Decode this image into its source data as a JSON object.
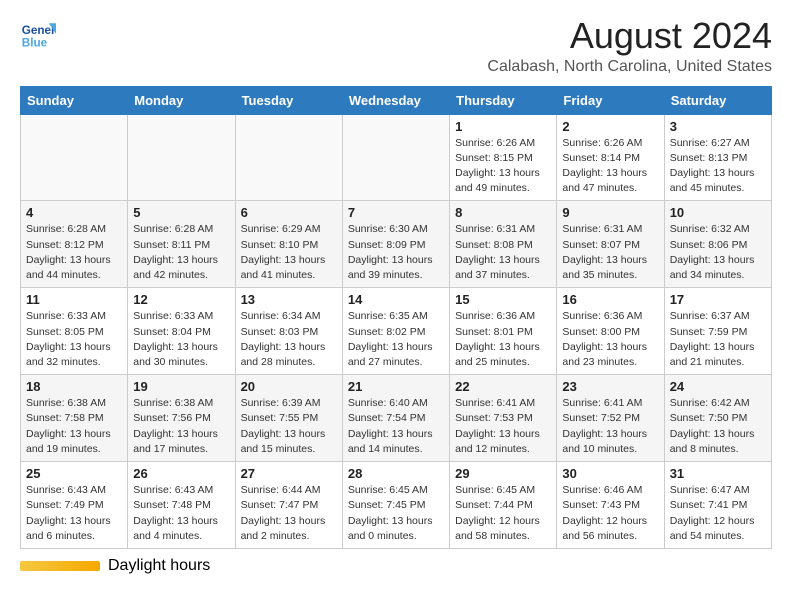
{
  "logo": {
    "general": "General",
    "blue": "Blue"
  },
  "header": {
    "month_year": "August 2024",
    "location": "Calabash, North Carolina, United States"
  },
  "days_of_week": [
    "Sunday",
    "Monday",
    "Tuesday",
    "Wednesday",
    "Thursday",
    "Friday",
    "Saturday"
  ],
  "weeks": [
    [
      {
        "day": "",
        "info": ""
      },
      {
        "day": "",
        "info": ""
      },
      {
        "day": "",
        "info": ""
      },
      {
        "day": "",
        "info": ""
      },
      {
        "day": "1",
        "info": "Sunrise: 6:26 AM\nSunset: 8:15 PM\nDaylight: 13 hours and 49 minutes."
      },
      {
        "day": "2",
        "info": "Sunrise: 6:26 AM\nSunset: 8:14 PM\nDaylight: 13 hours and 47 minutes."
      },
      {
        "day": "3",
        "info": "Sunrise: 6:27 AM\nSunset: 8:13 PM\nDaylight: 13 hours and 45 minutes."
      }
    ],
    [
      {
        "day": "4",
        "info": "Sunrise: 6:28 AM\nSunset: 8:12 PM\nDaylight: 13 hours and 44 minutes."
      },
      {
        "day": "5",
        "info": "Sunrise: 6:28 AM\nSunset: 8:11 PM\nDaylight: 13 hours and 42 minutes."
      },
      {
        "day": "6",
        "info": "Sunrise: 6:29 AM\nSunset: 8:10 PM\nDaylight: 13 hours and 41 minutes."
      },
      {
        "day": "7",
        "info": "Sunrise: 6:30 AM\nSunset: 8:09 PM\nDaylight: 13 hours and 39 minutes."
      },
      {
        "day": "8",
        "info": "Sunrise: 6:31 AM\nSunset: 8:08 PM\nDaylight: 13 hours and 37 minutes."
      },
      {
        "day": "9",
        "info": "Sunrise: 6:31 AM\nSunset: 8:07 PM\nDaylight: 13 hours and 35 minutes."
      },
      {
        "day": "10",
        "info": "Sunrise: 6:32 AM\nSunset: 8:06 PM\nDaylight: 13 hours and 34 minutes."
      }
    ],
    [
      {
        "day": "11",
        "info": "Sunrise: 6:33 AM\nSunset: 8:05 PM\nDaylight: 13 hours and 32 minutes."
      },
      {
        "day": "12",
        "info": "Sunrise: 6:33 AM\nSunset: 8:04 PM\nDaylight: 13 hours and 30 minutes."
      },
      {
        "day": "13",
        "info": "Sunrise: 6:34 AM\nSunset: 8:03 PM\nDaylight: 13 hours and 28 minutes."
      },
      {
        "day": "14",
        "info": "Sunrise: 6:35 AM\nSunset: 8:02 PM\nDaylight: 13 hours and 27 minutes."
      },
      {
        "day": "15",
        "info": "Sunrise: 6:36 AM\nSunset: 8:01 PM\nDaylight: 13 hours and 25 minutes."
      },
      {
        "day": "16",
        "info": "Sunrise: 6:36 AM\nSunset: 8:00 PM\nDaylight: 13 hours and 23 minutes."
      },
      {
        "day": "17",
        "info": "Sunrise: 6:37 AM\nSunset: 7:59 PM\nDaylight: 13 hours and 21 minutes."
      }
    ],
    [
      {
        "day": "18",
        "info": "Sunrise: 6:38 AM\nSunset: 7:58 PM\nDaylight: 13 hours and 19 minutes."
      },
      {
        "day": "19",
        "info": "Sunrise: 6:38 AM\nSunset: 7:56 PM\nDaylight: 13 hours and 17 minutes."
      },
      {
        "day": "20",
        "info": "Sunrise: 6:39 AM\nSunset: 7:55 PM\nDaylight: 13 hours and 15 minutes."
      },
      {
        "day": "21",
        "info": "Sunrise: 6:40 AM\nSunset: 7:54 PM\nDaylight: 13 hours and 14 minutes."
      },
      {
        "day": "22",
        "info": "Sunrise: 6:41 AM\nSunset: 7:53 PM\nDaylight: 13 hours and 12 minutes."
      },
      {
        "day": "23",
        "info": "Sunrise: 6:41 AM\nSunset: 7:52 PM\nDaylight: 13 hours and 10 minutes."
      },
      {
        "day": "24",
        "info": "Sunrise: 6:42 AM\nSunset: 7:50 PM\nDaylight: 13 hours and 8 minutes."
      }
    ],
    [
      {
        "day": "25",
        "info": "Sunrise: 6:43 AM\nSunset: 7:49 PM\nDaylight: 13 hours and 6 minutes."
      },
      {
        "day": "26",
        "info": "Sunrise: 6:43 AM\nSunset: 7:48 PM\nDaylight: 13 hours and 4 minutes."
      },
      {
        "day": "27",
        "info": "Sunrise: 6:44 AM\nSunset: 7:47 PM\nDaylight: 13 hours and 2 minutes."
      },
      {
        "day": "28",
        "info": "Sunrise: 6:45 AM\nSunset: 7:45 PM\nDaylight: 13 hours and 0 minutes."
      },
      {
        "day": "29",
        "info": "Sunrise: 6:45 AM\nSunset: 7:44 PM\nDaylight: 12 hours and 58 minutes."
      },
      {
        "day": "30",
        "info": "Sunrise: 6:46 AM\nSunset: 7:43 PM\nDaylight: 12 hours and 56 minutes."
      },
      {
        "day": "31",
        "info": "Sunrise: 6:47 AM\nSunset: 7:41 PM\nDaylight: 12 hours and 54 minutes."
      }
    ]
  ],
  "footer": {
    "daylight_label": "Daylight hours"
  }
}
